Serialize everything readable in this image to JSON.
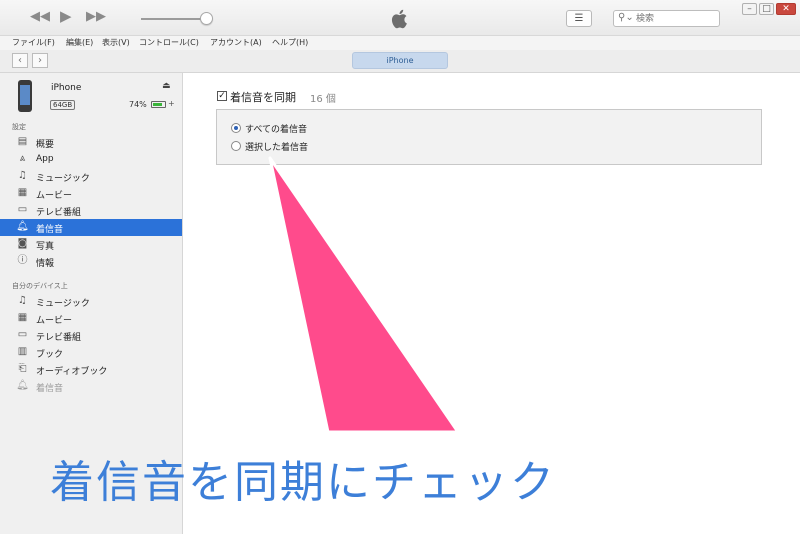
{
  "search": {
    "placeholder": "検索"
  },
  "menu": [
    "ファイル(F)",
    "編集(E)",
    "表示(V)",
    "コントロール(C)",
    "アカウント(A)",
    "ヘルプ(H)"
  ],
  "nav": {
    "device_tab": "iPhone"
  },
  "device": {
    "name": "iPhone",
    "capacity": "64GB",
    "battery": "74%"
  },
  "sidebar": {
    "settings_heading": "設定",
    "settings_items": [
      "概要",
      "App",
      "ミュージック",
      "ムービー",
      "テレビ番組",
      "着信音",
      "写真",
      "情報"
    ],
    "selected": "着信音",
    "ondevice_heading": "自分のデバイス上",
    "ondevice_items": [
      "ミュージック",
      "ムービー",
      "テレビ番組",
      "ブック",
      "オーディオブック",
      "着信音"
    ]
  },
  "main": {
    "sync_label": "着信音を同期",
    "sync_count": "16 個",
    "option_all": "すべての着信音",
    "option_selected": "選択した着信音"
  },
  "annotation": {
    "caption": "着信音を同期にチェック",
    "color": "#ff4b8c"
  }
}
